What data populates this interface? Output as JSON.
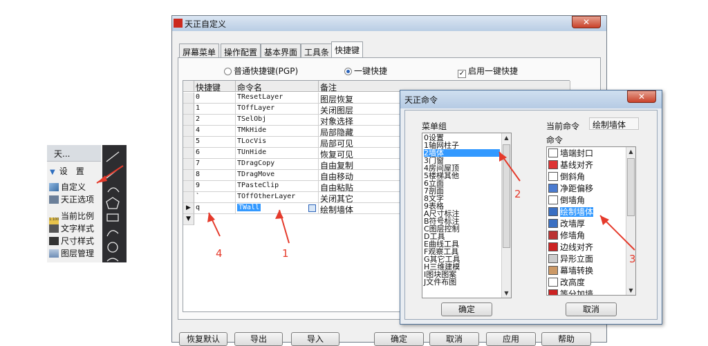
{
  "left_panel": {
    "header": "天...",
    "section": "设　置",
    "items": [
      "自定义",
      "天正选项",
      "当前比例",
      "文字样式",
      "尺寸样式",
      "图层管理"
    ],
    "ruler_label": "1:100"
  },
  "main_dialog": {
    "title": "天正自定义",
    "close_label": "✕",
    "tabs": [
      "屏幕菜单",
      "操作配置",
      "基本界面",
      "工具条",
      "快捷键"
    ],
    "options": {
      "radio_pgp": "普通快捷键(PGP)",
      "radio_onekey": "一键快捷",
      "check_enable": "启用一键快捷",
      "check_mark": "✓"
    },
    "grid": {
      "headers": [
        "快捷键",
        "命令名",
        "备注"
      ],
      "rows": [
        {
          "key": "0",
          "cmd": "TResetLayer",
          "note": "图层恢复"
        },
        {
          "key": "1",
          "cmd": "TOffLayer",
          "note": "关闭图层"
        },
        {
          "key": "2",
          "cmd": "TSelObj",
          "note": "对象选择"
        },
        {
          "key": "4",
          "cmd": "TMkHide",
          "note": "局部隐藏"
        },
        {
          "key": "5",
          "cmd": "TLocVis",
          "note": "局部可见"
        },
        {
          "key": "6",
          "cmd": "TUnHide",
          "note": "恢复可见"
        },
        {
          "key": "7",
          "cmd": "TDragCopy",
          "note": "自由复制"
        },
        {
          "key": "8",
          "cmd": "TDragMove",
          "note": "自由移动"
        },
        {
          "key": "9",
          "cmd": "TPasteClip",
          "note": "自由粘贴"
        },
        {
          "key": "`",
          "cmd": "TOffOtherLayer",
          "note": "关闭其它"
        },
        {
          "key": "q",
          "cmd": "TWall",
          "note": "绘制墙体"
        }
      ],
      "row_marker": "▶",
      "new_marker": "▼"
    },
    "buttons": [
      "恢复默认",
      "导出",
      "导入",
      "确定",
      "取消",
      "应用",
      "帮助"
    ]
  },
  "popup": {
    "title": "天正命令",
    "close_label": "✕",
    "menu_group_label": "菜单组",
    "menu_groups": [
      "0设置",
      "1轴网柱子",
      "2墙体",
      "3门窗",
      "4房间屋顶",
      "5楼梯其他",
      "6立面",
      "7剖面",
      "8文字",
      "9表格",
      "A尺寸标注",
      "B符号标注",
      "C图层控制",
      "D工具",
      "E曲线工具",
      "F观察工具",
      "G其它工具",
      "H三维建模",
      "I图块图案",
      "J文件布图"
    ],
    "current_cmd_label": "当前命令",
    "current_cmd_value": "绘制墙体",
    "cmd_label": "命令",
    "commands": [
      "墙端封口",
      "基线对齐",
      "倒斜角",
      "净距偏移",
      "倒墙角",
      "绘制墙体",
      "改墙厚",
      "修墙角",
      "边线对齐",
      "异形立面",
      "幕墙转换",
      "改高度",
      "等分加墙"
    ],
    "ok_button": "确定",
    "cancel_button": "取消"
  },
  "annotations": [
    "1",
    "2",
    "3",
    "4"
  ],
  "colors": {
    "accent": "#3399ff",
    "annotation": "#e53a2b",
    "title_bar": "#c5d6ea"
  }
}
